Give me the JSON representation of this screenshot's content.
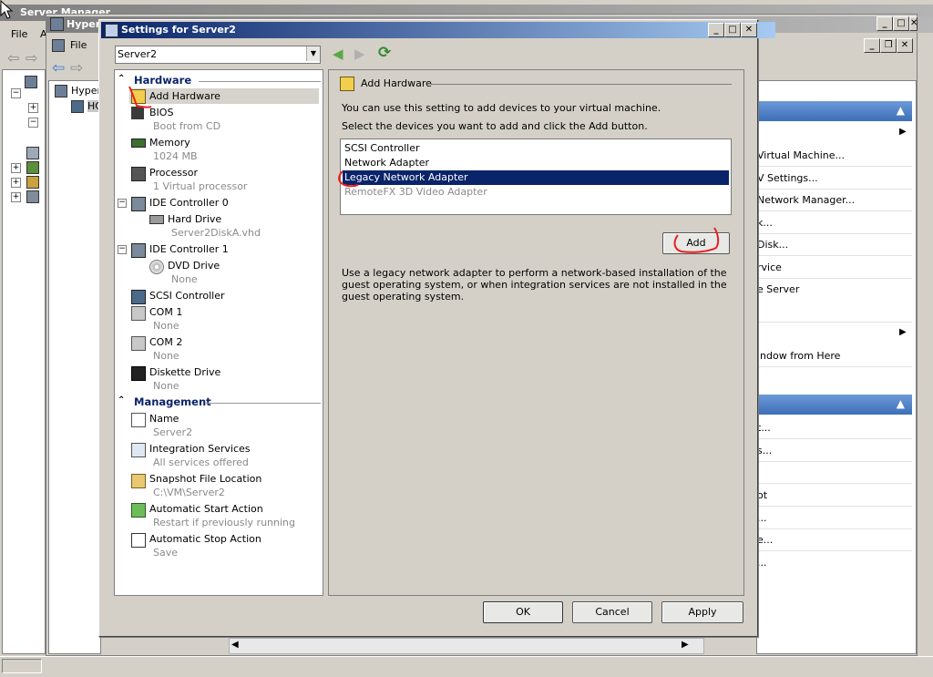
{
  "server_manager": {
    "title": "Server Manager",
    "menu_file": "File",
    "menu_a": "A"
  },
  "hyperv": {
    "title": "Hyper-V Manager",
    "menu_file": "File",
    "tree_root": "Hyper",
    "tree_node": "HC",
    "actions": [
      "Virtual Machine...",
      "V Settings...",
      "Network Manager...",
      "k...",
      "Disk...",
      "rvice",
      "e Server",
      "indow from Here",
      "t...",
      "s...",
      "ot",
      "...",
      "e...",
      "..."
    ]
  },
  "dialog": {
    "title": "Settings for Server2",
    "vm_select": "Server2",
    "hardware_header": "Hardware",
    "management_header": "Management",
    "hardware": [
      {
        "name": "Add Hardware",
        "sub": ""
      },
      {
        "name": "BIOS",
        "sub": "Boot from CD"
      },
      {
        "name": "Memory",
        "sub": "1024 MB"
      },
      {
        "name": "Processor",
        "sub": "1 Virtual processor"
      },
      {
        "name": "IDE Controller 0",
        "sub": ""
      },
      {
        "name": "Hard Drive",
        "sub": "Server2DiskA.vhd"
      },
      {
        "name": "IDE Controller 1",
        "sub": ""
      },
      {
        "name": "DVD Drive",
        "sub": "None"
      },
      {
        "name": "SCSI Controller",
        "sub": ""
      },
      {
        "name": "COM 1",
        "sub": "None"
      },
      {
        "name": "COM 2",
        "sub": "None"
      },
      {
        "name": "Diskette Drive",
        "sub": "None"
      }
    ],
    "management": [
      {
        "name": "Name",
        "sub": "Server2"
      },
      {
        "name": "Integration Services",
        "sub": "All services offered"
      },
      {
        "name": "Snapshot File Location",
        "sub": "C:\\VM\\Server2"
      },
      {
        "name": "Automatic Start Action",
        "sub": "Restart if previously running"
      },
      {
        "name": "Automatic Stop Action",
        "sub": "Save"
      }
    ],
    "panel": {
      "header": "Add Hardware",
      "line1": "You can use this setting to add devices to your virtual machine.",
      "line2": "Select the devices you want to add and click the Add button.",
      "devices": [
        "SCSI Controller",
        "Network Adapter",
        "Legacy Network Adapter",
        "RemoteFX 3D Video Adapter"
      ],
      "selected_index": 2,
      "add_button": "Add",
      "description": "Use a legacy network adapter to perform a network-based installation of the guest operating system, or when integration services are not installed in the guest operating system."
    },
    "buttons": {
      "ok": "OK",
      "cancel": "Cancel",
      "apply": "Apply"
    }
  },
  "colors": {
    "title_active": "#0a246a",
    "selection": "#0a246a",
    "annotation": "#e8201e",
    "disabled_text": "#8a8a8a"
  }
}
